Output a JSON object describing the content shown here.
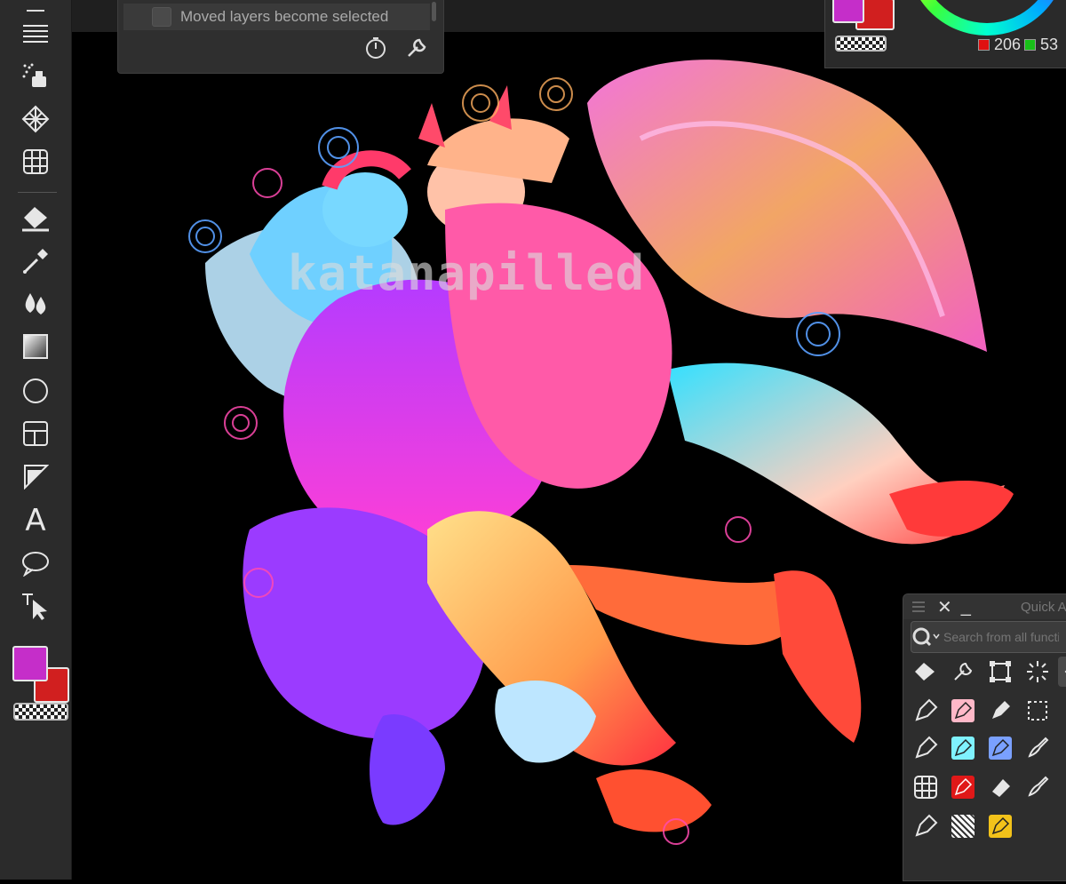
{
  "tool_property": {
    "option_label": "Moved layers become selected"
  },
  "color_panel": {
    "red_value": "206",
    "green_value": "53",
    "main_color": "#c52ec9",
    "sub_color": "#d11f1f"
  },
  "quick_access": {
    "title": "Quick A",
    "search_placeholder": "Search from all functi"
  },
  "artwork": {
    "watermark": "katanapilled"
  },
  "icons": {
    "toolbar": [
      "menu-icon",
      "spray-icon",
      "pattern-icon",
      "3d-grid-icon",
      "fill-icon",
      "eyedropper-icon",
      "blend-icon",
      "gradient-icon",
      "ellipse-icon",
      "frame-icon",
      "ruler-icon",
      "text-icon",
      "balloon-icon",
      "operation-icon"
    ]
  }
}
